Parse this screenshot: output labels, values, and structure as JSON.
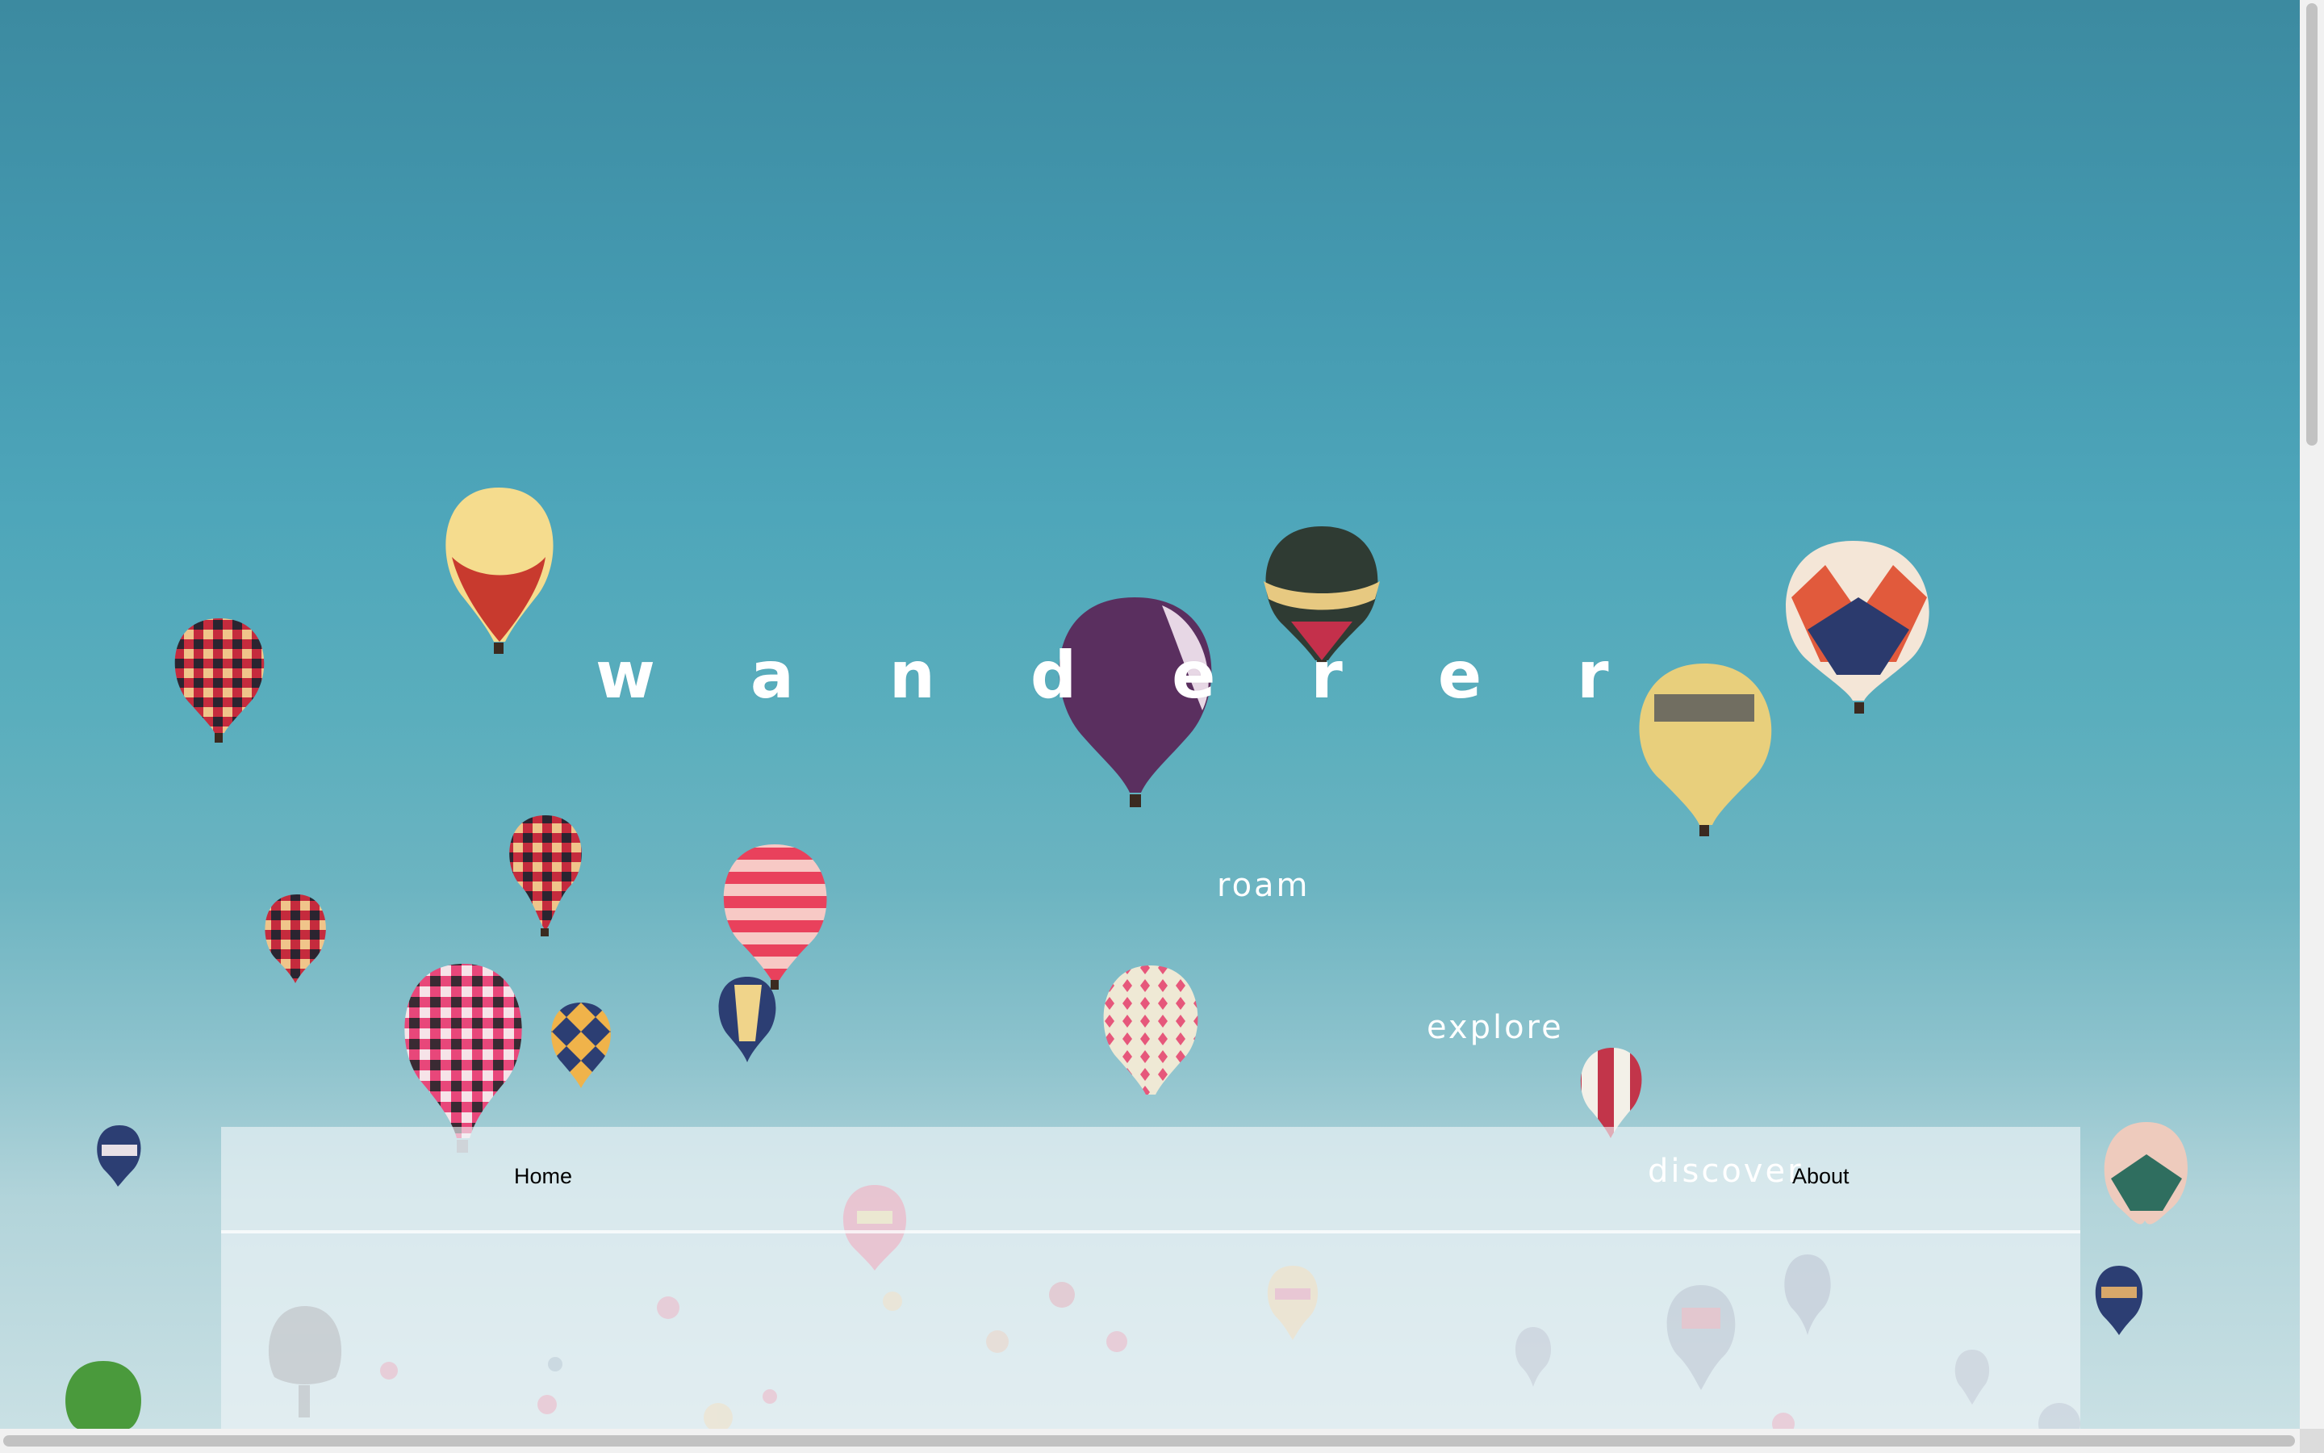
{
  "hero": {
    "title": "wanderer",
    "words": [
      "roam",
      "explore",
      "discover"
    ]
  },
  "nav": {
    "home_label": "Home",
    "about_label": "About"
  },
  "colors": {
    "sky_top": "#3c8aa0",
    "sky_bottom": "#c9e0e4",
    "hero_text": "#ffffff",
    "nav_text": "#000000"
  },
  "background_image": "hot-air-balloons-over-blue-sky"
}
